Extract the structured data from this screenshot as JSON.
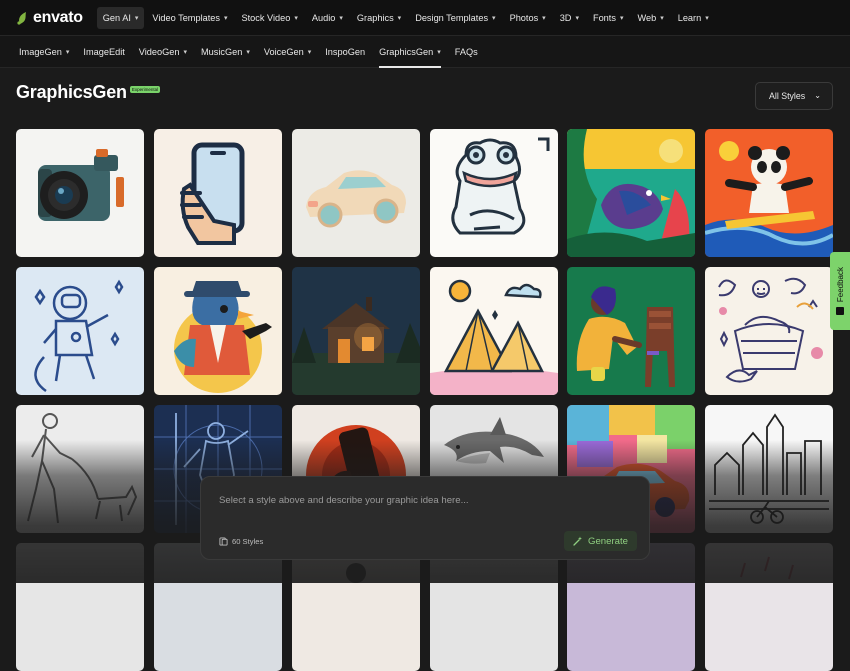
{
  "brand": {
    "name": "envato",
    "accent": "#82b541"
  },
  "top_nav": [
    {
      "label": "Gen AI",
      "active": true
    },
    {
      "label": "Video Templates"
    },
    {
      "label": "Stock Video"
    },
    {
      "label": "Audio"
    },
    {
      "label": "Graphics"
    },
    {
      "label": "Design Templates"
    },
    {
      "label": "Photos"
    },
    {
      "label": "3D"
    },
    {
      "label": "Fonts"
    },
    {
      "label": "Web"
    },
    {
      "label": "Learn"
    }
  ],
  "sub_nav": [
    {
      "label": "ImageGen",
      "dropdown": true
    },
    {
      "label": "ImageEdit",
      "dropdown": false
    },
    {
      "label": "VideoGen",
      "dropdown": true
    },
    {
      "label": "MusicGen",
      "dropdown": true
    },
    {
      "label": "VoiceGen",
      "dropdown": true
    },
    {
      "label": "InspoGen",
      "dropdown": false
    },
    {
      "label": "GraphicsGen",
      "dropdown": true,
      "active": true
    },
    {
      "label": "FAQs",
      "dropdown": false
    }
  ],
  "page": {
    "title": "GraphicsGen",
    "badge": "Experimental"
  },
  "filter": {
    "selected": "All Styles"
  },
  "style_tiles": [
    {
      "icon": "camera-3d"
    },
    {
      "icon": "hand-phone-flat"
    },
    {
      "icon": "clay-car"
    },
    {
      "icon": "frog-line"
    },
    {
      "icon": "bird-tropical"
    },
    {
      "icon": "panda-surf"
    },
    {
      "icon": "astronaut-line"
    },
    {
      "icon": "bird-detective"
    },
    {
      "icon": "cabin-night"
    },
    {
      "icon": "pyramids"
    },
    {
      "icon": "woman-painting-chair"
    },
    {
      "icon": "doodle-basket"
    },
    {
      "icon": "man-dog-sketch"
    },
    {
      "icon": "statue-blueprint"
    },
    {
      "icon": "hand-phone-red"
    },
    {
      "icon": "dolphin-3d"
    },
    {
      "icon": "car-paint"
    },
    {
      "icon": "city-line"
    }
  ],
  "prompt": {
    "placeholder": "Select a style above and describe your graphic idea here...",
    "style_count": "60 Styles",
    "generate_label": "Generate"
  },
  "feedback": {
    "label": "Feedback",
    "color": "#7dd36b"
  }
}
